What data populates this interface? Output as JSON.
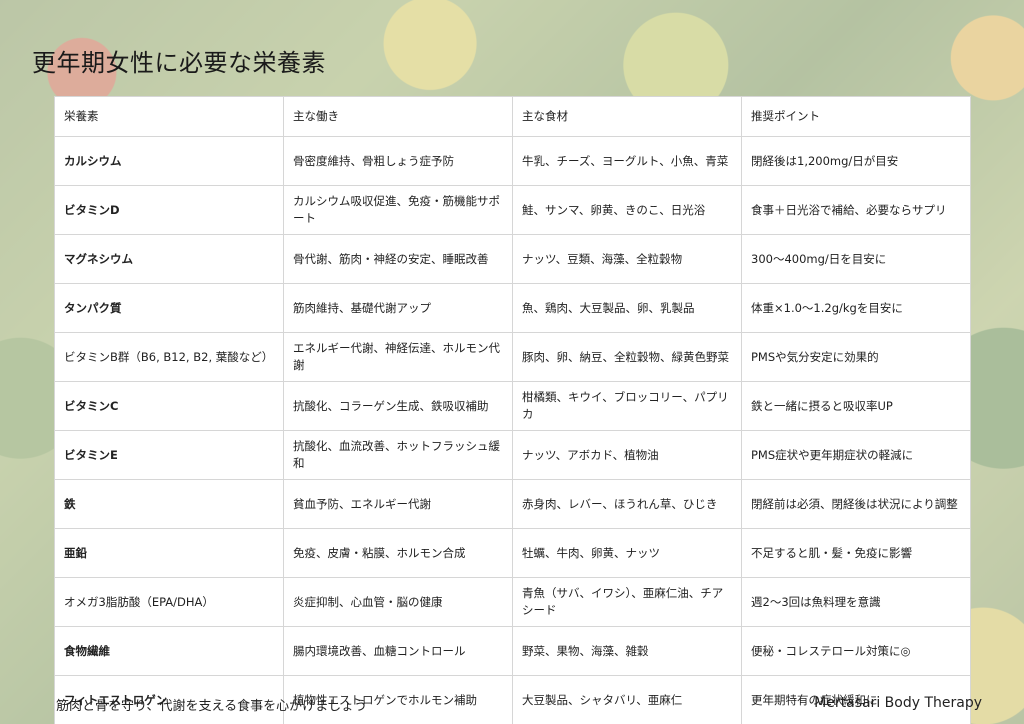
{
  "title": "更年期女性に必要な栄養素",
  "table": {
    "headers": [
      "栄養素",
      "主な働き",
      "主な食材",
      "推奨ポイント"
    ],
    "rows": [
      {
        "nutrient": "カルシウム",
        "bold": true,
        "function": "骨密度維持、骨粗しょう症予防",
        "foods": "牛乳、チーズ、ヨーグルト、小魚、青菜",
        "point": "閉経後は1,200mg/日が目安"
      },
      {
        "nutrient": "ビタミンD",
        "bold": true,
        "function": "カルシウム吸収促進、免疫・筋機能サポート",
        "foods": "鮭、サンマ、卵黄、きのこ、日光浴",
        "point": "食事＋日光浴で補給、必要ならサプリ"
      },
      {
        "nutrient": "マグネシウム",
        "bold": true,
        "function": "骨代謝、筋肉・神経の安定、睡眠改善",
        "foods": "ナッツ、豆類、海藻、全粒穀物",
        "point": "300〜400mg/日を目安に"
      },
      {
        "nutrient": "タンパク質",
        "bold": true,
        "function": "筋肉維持、基礎代謝アップ",
        "foods": "魚、鶏肉、大豆製品、卵、乳製品",
        "point": "体重×1.0〜1.2g/kgを目安に"
      },
      {
        "nutrient": "ビタミンB群（B6, B12, B2, 葉酸など）",
        "bold": false,
        "function": "エネルギー代謝、神経伝達、ホルモン代謝",
        "foods": "豚肉、卵、納豆、全粒穀物、緑黄色野菜",
        "point": "PMSや気分安定に効果的"
      },
      {
        "nutrient": "ビタミンC",
        "bold": true,
        "function": "抗酸化、コラーゲン生成、鉄吸収補助",
        "foods": "柑橘類、キウイ、ブロッコリー、パプリカ",
        "point": "鉄と一緒に摂ると吸収率UP"
      },
      {
        "nutrient": "ビタミンE",
        "bold": true,
        "function": "抗酸化、血流改善、ホットフラッシュ緩和",
        "foods": "ナッツ、アボカド、植物油",
        "point": "PMS症状や更年期症状の軽減に"
      },
      {
        "nutrient": "鉄",
        "bold": true,
        "function": "貧血予防、エネルギー代謝",
        "foods": "赤身肉、レバー、ほうれん草、ひじき",
        "point": "閉経前は必須、閉経後は状況により調整"
      },
      {
        "nutrient": "亜鉛",
        "bold": true,
        "function": "免疫、皮膚・粘膜、ホルモン合成",
        "foods": "牡蠣、牛肉、卵黄、ナッツ",
        "point": "不足すると肌・髪・免疫に影響"
      },
      {
        "nutrient": "オメガ3脂肪酸（EPA/DHA）",
        "bold": false,
        "function": "炎症抑制、心血管・脳の健康",
        "foods": "青魚（サバ、イワシ）、亜麻仁油、チアシード",
        "point": "週2〜3回は魚料理を意識"
      },
      {
        "nutrient": "食物繊維",
        "bold": true,
        "function": "腸内環境改善、血糖コントロール",
        "foods": "野菜、果物、海藻、雑穀",
        "point": "便秘・コレステロール対策に◎"
      },
      {
        "nutrient": "フィトエストロゲン",
        "bold": true,
        "function": "植物性エストロゲンでホルモン補助",
        "foods": "大豆製品、シャタバリ、亜麻仁",
        "point": "更年期特有の症状緩和に"
      }
    ]
  },
  "footer": {
    "message": "筋肉と骨を守り、代謝を支える食事を心がけましょう",
    "brand": "Mertasari Body Therapy"
  }
}
